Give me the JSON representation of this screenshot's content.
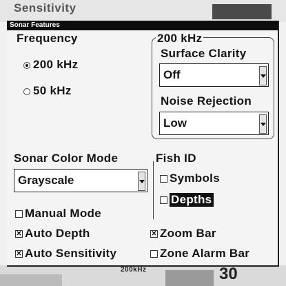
{
  "background": {
    "title": "Sensitivity",
    "bottom_label": "200kHz",
    "bottom_value": "30"
  },
  "dialog": {
    "title": "Sonar Features",
    "frequency": {
      "label": "Frequency",
      "options": [
        "200 kHz",
        "50 kHz"
      ],
      "selected": "200 kHz"
    },
    "freq_group": {
      "label": "200 kHz",
      "surface_clarity": {
        "label": "Surface Clarity",
        "value": "Off"
      },
      "noise_rejection": {
        "label": "Noise Rejection",
        "value": "Low"
      }
    },
    "color_mode": {
      "label": "Sonar Color Mode",
      "value": "Grayscale"
    },
    "fish_id": {
      "label": "Fish ID",
      "symbols": {
        "label": "Symbols",
        "checked": false
      },
      "depths": {
        "label": "Depths",
        "checked": false
      }
    },
    "manual_mode": {
      "label": "Manual Mode",
      "checked": false
    },
    "auto_depth": {
      "label": "Auto Depth",
      "checked": true
    },
    "auto_sensitivity": {
      "label": "Auto Sensitivity",
      "checked": true
    },
    "zoom_bar": {
      "label": "Zoom Bar",
      "checked": true
    },
    "zone_alarm_bar": {
      "label": "Zone Alarm Bar",
      "checked": false
    },
    "check_mark": "✕"
  }
}
